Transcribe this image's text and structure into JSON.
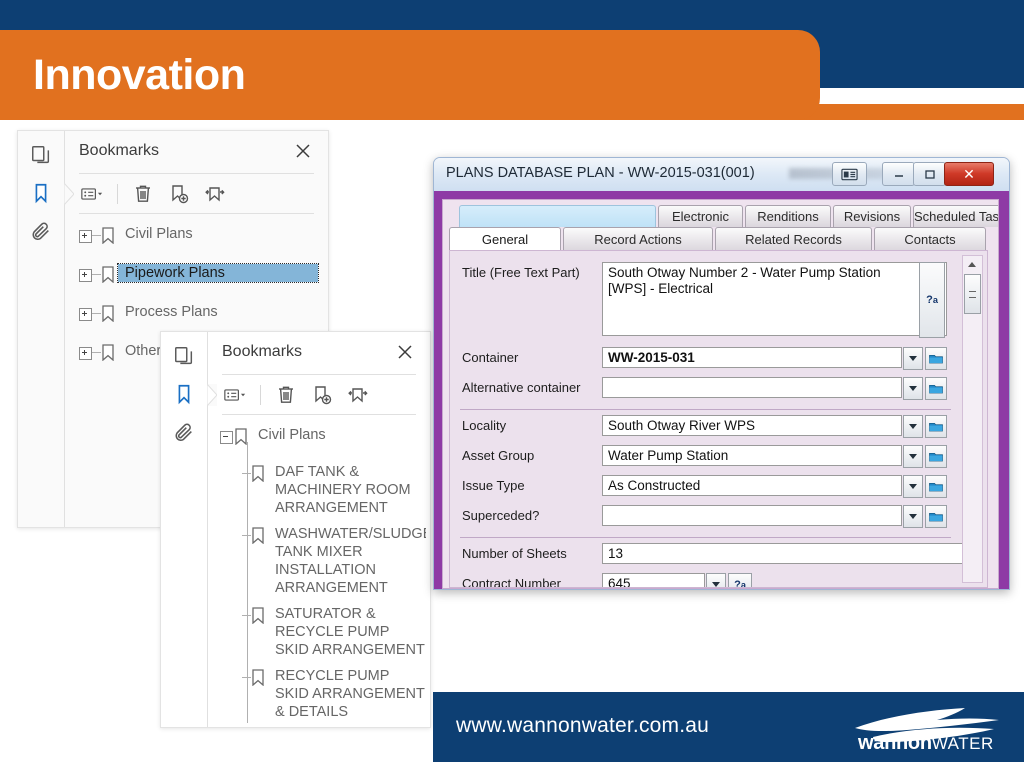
{
  "slide": {
    "title": "Innovation",
    "colors": {
      "header_blue": "#0d3f73",
      "accent_orange": "#e1711f",
      "dialog_purple": "#8e3aa5",
      "selection_blue": "#84b5d8"
    }
  },
  "footer": {
    "url": "www.wannonwater.com.au",
    "brand_primary": "wannon",
    "brand_secondary": "WATER",
    "logo_icon": "wave-logo-icon"
  },
  "bookmarks_panel_back": {
    "title": "Bookmarks",
    "close_label": "×",
    "rail": [
      {
        "name": "pages-thumbnail-icon",
        "label": "Page Thumbnails"
      },
      {
        "name": "bookmark-icon",
        "label": "Bookmarks",
        "active": true
      },
      {
        "name": "paperclip-icon",
        "label": "Attachments"
      }
    ],
    "toolbar": [
      {
        "name": "options-menu-icon",
        "label": "Options"
      },
      {
        "name": "delete-bookmark-icon",
        "label": "Delete Bookmark"
      },
      {
        "name": "new-bookmark-icon",
        "label": "New Bookmark"
      },
      {
        "name": "expand-bookmark-icon",
        "label": "Expand Current Bookmark"
      }
    ],
    "items": [
      {
        "label": "Civil Plans",
        "expanded": false,
        "selected": false
      },
      {
        "label": "Pipework Plans",
        "expanded": false,
        "selected": true
      },
      {
        "label": "Process Plans",
        "expanded": false,
        "selected": false
      },
      {
        "label": "Other",
        "expanded": false,
        "selected": false
      }
    ]
  },
  "bookmarks_panel_front": {
    "title": "Bookmarks",
    "close_label": "×",
    "rail": [
      {
        "name": "pages-thumbnail-icon",
        "label": "Page Thumbnails"
      },
      {
        "name": "bookmark-icon",
        "label": "Bookmarks",
        "active": true
      },
      {
        "name": "paperclip-icon",
        "label": "Attachments"
      }
    ],
    "toolbar": [
      {
        "name": "options-menu-icon",
        "label": "Options"
      },
      {
        "name": "delete-bookmark-icon",
        "label": "Delete Bookmark"
      },
      {
        "name": "new-bookmark-icon",
        "label": "New Bookmark"
      },
      {
        "name": "expand-bookmark-icon",
        "label": "Expand Current Bookmark"
      }
    ],
    "root": {
      "label": "Civil Plans",
      "expanded": true
    },
    "children": [
      {
        "label": "DAF TANK & MACHINERY ROOM ARRANGEMENT"
      },
      {
        "label": "WASHWATER/SLUDGE TANK MIXER INSTALLATION ARRANGEMENT"
      },
      {
        "label": "SATURATOR & RECYCLE PUMP SKID ARRANGEMENT"
      },
      {
        "label": "RECYCLE PUMP SKID ARRANGEMENT & DETAILS"
      }
    ]
  },
  "db_dialog": {
    "title": "PLANS DATABASE PLAN - WW-2015-031(001)",
    "window_buttons": [
      {
        "name": "document-view-button",
        "glyph": "▤"
      },
      {
        "name": "minimize-button",
        "glyph": "–"
      },
      {
        "name": "maximize-button",
        "glyph": "□"
      },
      {
        "name": "close-button",
        "glyph": "✕"
      }
    ],
    "tabs_top": [
      {
        "label": "",
        "blank": true
      },
      {
        "label": "Electronic"
      },
      {
        "label": "Renditions"
      },
      {
        "label": "Revisions"
      },
      {
        "label": "Scheduled Tasks"
      }
    ],
    "tabs_bottom": [
      {
        "label": "General",
        "active": true
      },
      {
        "label": "Record Actions"
      },
      {
        "label": "Related Records"
      },
      {
        "label": "Contacts"
      }
    ],
    "fields": [
      {
        "label": "Title (Free Text Part)",
        "value": "South Otway Number 2 - Water Pump Station [WPS] - Electrical",
        "type": "textarea",
        "keyword_button": "keyword-lookup-icon"
      },
      {
        "label": "Container",
        "value": "WW-2015-031",
        "type": "combo",
        "bold": true
      },
      {
        "label": "Alternative container",
        "value": "",
        "type": "combo"
      },
      {
        "label": "Locality",
        "value": "South Otway River WPS",
        "type": "combo"
      },
      {
        "label": "Asset Group",
        "value": "Water Pump Station",
        "type": "combo"
      },
      {
        "label": "Issue Type",
        "value": "As Constructed",
        "type": "combo"
      },
      {
        "label": "Superceded?",
        "value": "",
        "type": "combo"
      },
      {
        "label": "Number of Sheets",
        "value": "13",
        "type": "text"
      },
      {
        "label": "Contract Number",
        "value": "645",
        "type": "combo-keyword"
      }
    ]
  }
}
